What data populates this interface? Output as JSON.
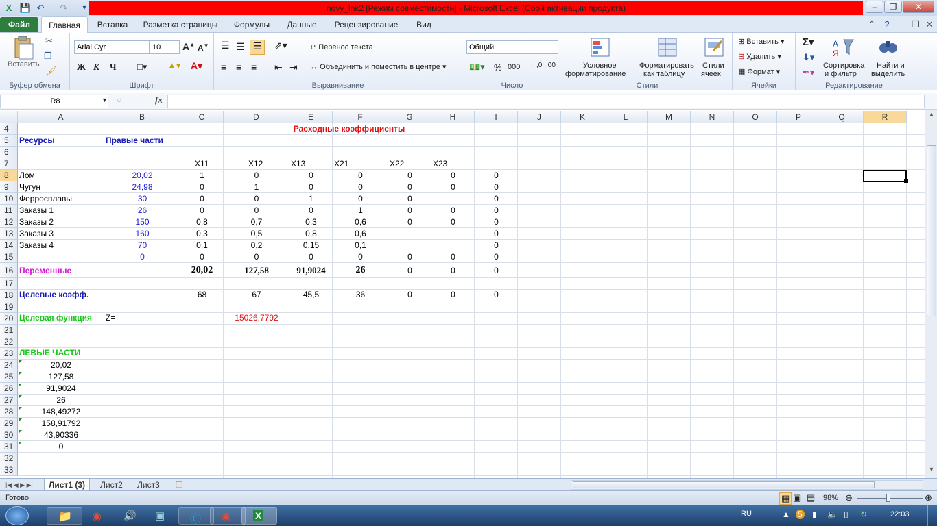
{
  "window": {
    "title": "novy_lnk2  [Режим совместимости]  -  Microsoft Excel (Сбой активации продукта)"
  },
  "menu": {
    "file": "Файл",
    "tabs": [
      "Главная",
      "Вставка",
      "Разметка страницы",
      "Формулы",
      "Данные",
      "Рецензирование",
      "Вид"
    ]
  },
  "ribbon": {
    "clipboard": {
      "paste": "Вставить",
      "group": "Буфер обмена"
    },
    "font": {
      "name": "Arial Cyr",
      "size": "10",
      "group": "Шрифт",
      "bold": "Ж",
      "italic": "К",
      "underline": "Ч"
    },
    "alignment": {
      "wrap": "Перенос текста",
      "merge": "Объединить и поместить в центре",
      "group": "Выравнивание"
    },
    "number": {
      "format": "Общий",
      "group": "Число",
      "percent": "%",
      "thousands": "000"
    },
    "styles": {
      "conditional1": "Условное",
      "conditional2": "форматирование",
      "table1": "Форматировать",
      "table2": "как таблицу",
      "cell1": "Стили",
      "cell2": "ячеек",
      "group": "Стили"
    },
    "cells": {
      "insert": "Вставить",
      "delete": "Удалить",
      "format": "Формат",
      "group": "Ячейки"
    },
    "editing": {
      "sort1": "Сортировка",
      "sort2": "и фильтр",
      "find1": "Найти и",
      "find2": "выделить",
      "group": "Редактирование"
    }
  },
  "formula_bar": {
    "name_box": "R8",
    "fx": "fx",
    "formula": ""
  },
  "columns": [
    "A",
    "B",
    "C",
    "D",
    "E",
    "F",
    "G",
    "H",
    "I",
    "J",
    "K",
    "L",
    "M",
    "N",
    "O",
    "P",
    "Q",
    "R"
  ],
  "selected_column": "R",
  "rows": [
    "4",
    "5",
    "6",
    "7",
    "8",
    "9",
    "10",
    "11",
    "12",
    "13",
    "14",
    "15",
    "16",
    "17",
    "18",
    "19",
    "20",
    "21",
    "22",
    "23",
    "24",
    "25",
    "26",
    "27",
    "28",
    "29",
    "30",
    "31",
    "32",
    "33"
  ],
  "selected_row": "8",
  "cells": {
    "title": "Расходные коэффициенты",
    "resources_hdr": "Ресурсы",
    "rhs_hdr": "Правые  части",
    "vars": [
      "X11",
      "X12",
      "X13",
      "X21",
      "X22",
      "X23"
    ],
    "r8": {
      "a": "Лом",
      "b": "20,02",
      "c": "1",
      "d": "0",
      "e": "0",
      "f": "0",
      "g": "0",
      "h": "0",
      "i": "0"
    },
    "r9": {
      "a": "Чугун",
      "b": "24,98",
      "c": "0",
      "d": "1",
      "e": "0",
      "f": "0",
      "g": "0",
      "h": "0",
      "i": "0"
    },
    "r10": {
      "a": "Ферросплавы",
      "b": "30",
      "c": "0",
      "d": "0",
      "e": "1",
      "f": "0",
      "g": "0",
      "i": "0"
    },
    "r11": {
      "a": "Заказы 1",
      "b": "26",
      "c": "0",
      "d": "0",
      "e": "0",
      "f": "1",
      "g": "0",
      "h": "0",
      "i": "0"
    },
    "r12": {
      "a": "Заказы 2",
      "b": "150",
      "c": "0,8",
      "d": "0,7",
      "e": "0,3",
      "f": "0,6",
      "g": "0",
      "h": "0",
      "i": "0"
    },
    "r13": {
      "a": "Заказы 3",
      "b": "160",
      "c": "0,3",
      "d": "0,5",
      "e": "0,8",
      "f": "0,6",
      "i": "0"
    },
    "r14": {
      "a": "Заказы 4",
      "b": "70",
      "c": "0,1",
      "d": "0,2",
      "e": "0,15",
      "f": "0,1",
      "i": "0"
    },
    "r15": {
      "b": "0",
      "c": "0",
      "d": "0",
      "e": "0",
      "f": "0",
      "g": "0",
      "h": "0",
      "i": "0"
    },
    "r16": {
      "a": "Переменные",
      "c": "20,02",
      "d": "127,58",
      "e": "91,9024",
      "f": "26",
      "g": "0",
      "h": "0",
      "i": "0"
    },
    "r18": {
      "a": "Целевые коэфф.",
      "c": "68",
      "d": "67",
      "e": "45,5",
      "f": "36",
      "g": "0",
      "h": "0",
      "i": "0"
    },
    "r20": {
      "a": "Целевая функция",
      "b": "Z=",
      "d": "15026,7792"
    },
    "r23": {
      "a": "ЛЕВЫЕ ЧАСТИ"
    },
    "left_parts": [
      "20,02",
      "127,58",
      "91,9024",
      "26",
      "148,49272",
      "158,91792",
      "43,90336",
      "0"
    ]
  },
  "sheets": {
    "tabs": [
      "Лист1 (3)",
      "Лист2",
      "Лист3"
    ],
    "active": 0
  },
  "status": {
    "ready": "Готово",
    "zoom": "98%"
  },
  "taskbar": {
    "lang": "RU",
    "time": "22:03"
  },
  "colors": {
    "accent_green": "#2c7d3e",
    "selection_orange": "#f9d99a"
  }
}
